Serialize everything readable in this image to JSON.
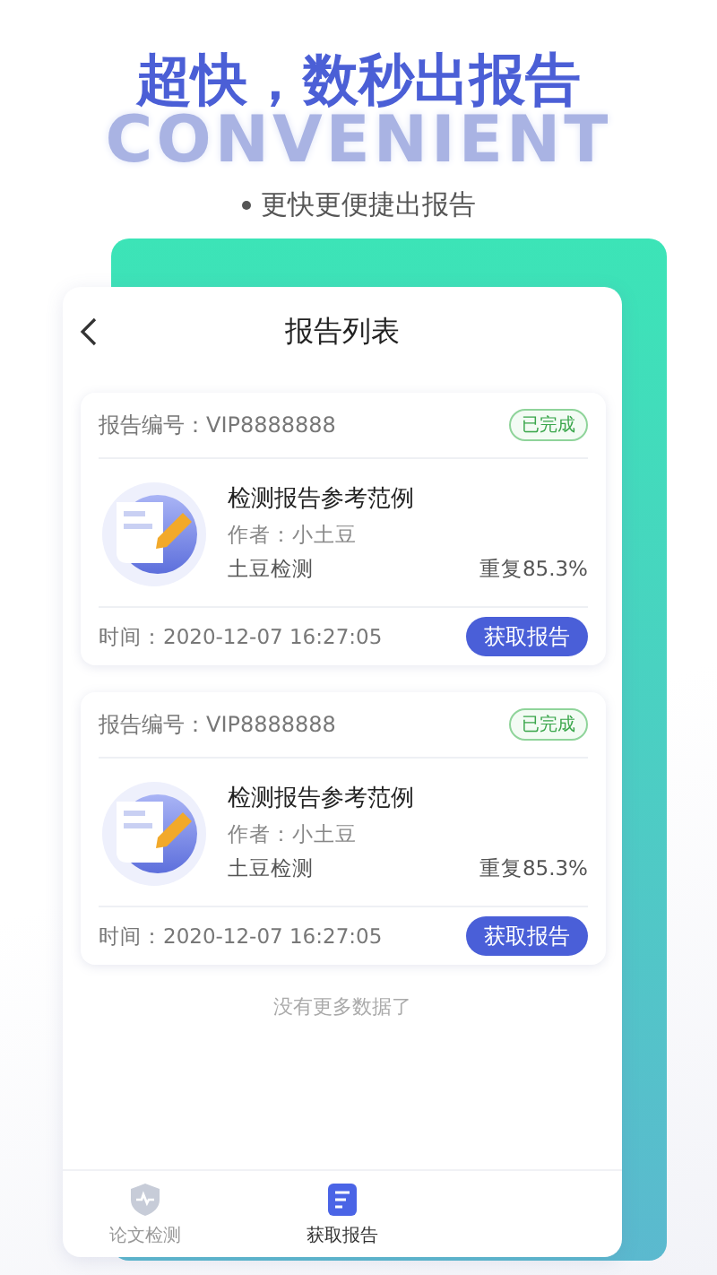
{
  "headline": "超快，数秒出报告",
  "background_word": "CONVENIENT",
  "subtitle": "更快更便捷出报告",
  "screen": {
    "title": "报告列表",
    "reports": [
      {
        "number_label": "报告编号：VIP8888888",
        "status": "已完成",
        "title": "检测报告参考范例",
        "author": "作者：小土豆",
        "source": "土豆检测",
        "similarity": "重复85.3%",
        "time": "时间：2020-12-07 16:27:05",
        "action": "获取报告"
      },
      {
        "number_label": "报告编号：VIP8888888",
        "status": "已完成",
        "title": "检测报告参考范例",
        "author": "作者：小土豆",
        "source": "土豆检测",
        "similarity": "重复85.3%",
        "time": "时间：2020-12-07 16:27:05",
        "action": "获取报告"
      }
    ],
    "end_note": "没有更多数据了",
    "tabs": [
      {
        "kind": "shield",
        "label": "论文检测",
        "selected": false
      },
      {
        "kind": "document",
        "label": "获取报告",
        "selected": true
      }
    ]
  }
}
